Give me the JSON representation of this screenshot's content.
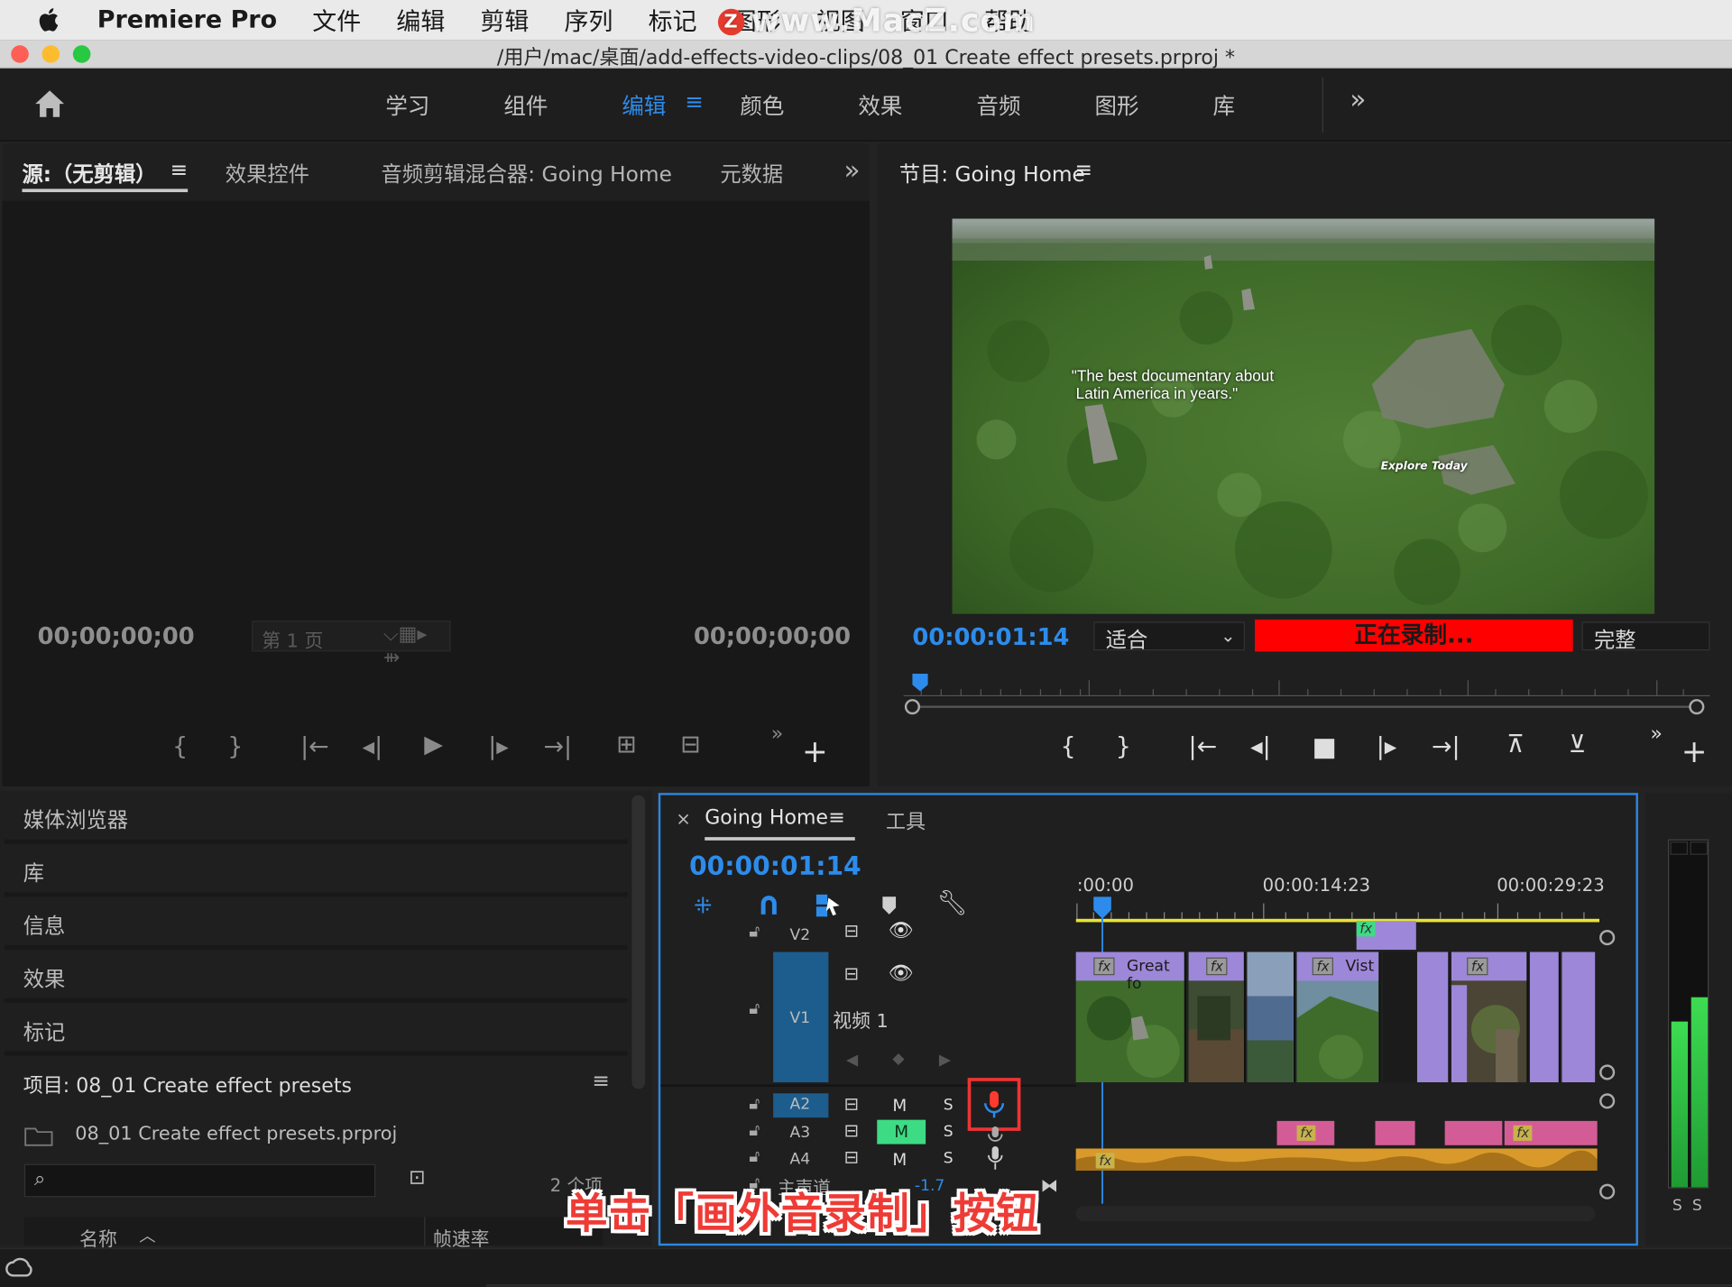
{
  "menubar": {
    "app": "Premiere Pro",
    "items": [
      "文件",
      "编辑",
      "剪辑",
      "序列",
      "标记",
      "图形",
      "视图",
      "窗口",
      "帮助"
    ],
    "watermark": "www.MacZ.com"
  },
  "window": {
    "title": "/用户/mac/桌面/add-effects-video-clips/08_01 Create effect presets.prproj *"
  },
  "workspaces": {
    "items": [
      "学习",
      "组件",
      "编辑",
      "颜色",
      "效果",
      "音频",
      "图形",
      "库"
    ],
    "active": "编辑",
    "overflow": "»"
  },
  "source_panel": {
    "tabs": [
      "源:（无剪辑）",
      "效果控件",
      "音频剪辑混合器: Going Home",
      "元数据"
    ],
    "timecode_left": "00;00;00;00",
    "timecode_right": "00;00;00;00",
    "page_select": "第 1 页"
  },
  "program_panel": {
    "tab": "节目: Going Home",
    "timecode": "00:00:01:14",
    "fit": "适合",
    "recording": "正在录制...",
    "quality": "完整",
    "video_quote_line1": "\"The best documentary about",
    "video_quote_line2": "Latin America in years.\"",
    "video_tag": "Explore Today"
  },
  "left_panels": {
    "items": [
      "媒体浏览器",
      "库",
      "信息",
      "效果",
      "标记"
    ],
    "project_title": "项目: 08_01 Create effect presets",
    "project_file": "08_01 Create effect presets.prproj",
    "item_count": "2 个项",
    "col_name": "名称",
    "col_fps": "帧速率"
  },
  "timeline": {
    "tab": "Going Home",
    "tab2": "工具",
    "timecode": "00:00:01:14",
    "ruler": [
      ":00:00",
      "00:00:14:23",
      "00:00:29:23"
    ],
    "tracks": {
      "v2": "V2",
      "v1": "V1",
      "v1_name": "视频 1",
      "a2": "A2",
      "a3": "A3",
      "a4": "A4",
      "mute": "M",
      "solo": "S",
      "master": "主声道",
      "master_val": "-1.7"
    },
    "clips": {
      "great": "Great fo",
      "vist": "Vist",
      "fx": "fx"
    }
  },
  "meters": {
    "solo_left": "S",
    "solo_right": "S"
  },
  "callout": "单击「画外音录制」按钮",
  "colors": {
    "accent": "#2d8ceb",
    "recording": "#ff0000",
    "clip_video": "#9d87d8",
    "clip_audio": "#d45c96",
    "clip_music": "#d99a2b",
    "highlight_border": "#ee3333"
  }
}
